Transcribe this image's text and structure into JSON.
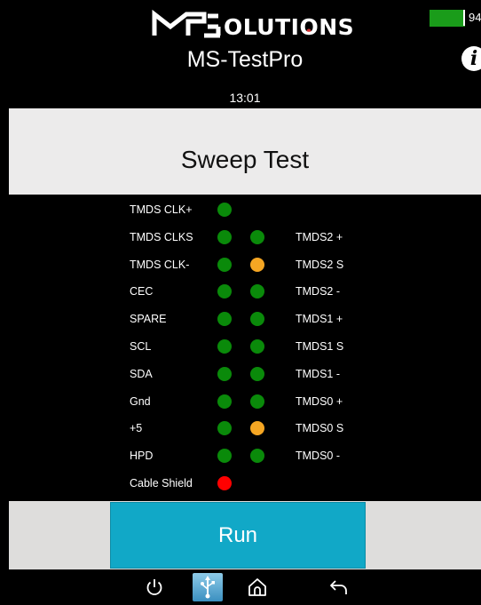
{
  "header": {
    "brand": "MSOLUTIONS",
    "app_title": "MS-TestPro",
    "time": "13:01",
    "battery_percent": "94%",
    "battery_level": 0.94,
    "battery_color": "#1a9c1a",
    "info_icon": "i"
  },
  "test": {
    "title": "Sweep Test"
  },
  "status_colors": {
    "pass": "#0a8a0a",
    "warn": "#f5a623",
    "fail": "#ff0000"
  },
  "pins": [
    {
      "left_label": "TMDS CLK+",
      "left_status": "pass",
      "right_label": "",
      "right_status": null
    },
    {
      "left_label": "TMDS CLKS",
      "left_status": "pass",
      "right_label": "TMDS2 +",
      "right_status": "pass"
    },
    {
      "left_label": "TMDS CLK-",
      "left_status": "pass",
      "right_label": "TMDS2 S",
      "right_status": "warn"
    },
    {
      "left_label": "CEC",
      "left_status": "pass",
      "right_label": "TMDS2 -",
      "right_status": "pass"
    },
    {
      "left_label": "SPARE",
      "left_status": "pass",
      "right_label": "TMDS1 +",
      "right_status": "pass"
    },
    {
      "left_label": "SCL",
      "left_status": "pass",
      "right_label": "TMDS1 S",
      "right_status": "pass"
    },
    {
      "left_label": "SDA",
      "left_status": "pass",
      "right_label": "TMDS1 -",
      "right_status": "pass"
    },
    {
      "left_label": "Gnd",
      "left_status": "pass",
      "right_label": "TMDS0 +",
      "right_status": "pass"
    },
    {
      "left_label": "+5",
      "left_status": "pass",
      "right_label": "TMDS0 S",
      "right_status": "warn"
    },
    {
      "left_label": "HPD",
      "left_status": "pass",
      "right_label": "TMDS0 -",
      "right_status": "pass"
    },
    {
      "left_label": "Cable Shield",
      "left_status": "fail",
      "right_label": "",
      "right_status": null
    }
  ],
  "actions": {
    "run_label": "Run"
  },
  "navbar": {
    "items": [
      "power-icon",
      "usb-icon",
      "home-icon",
      "back-icon"
    ]
  }
}
